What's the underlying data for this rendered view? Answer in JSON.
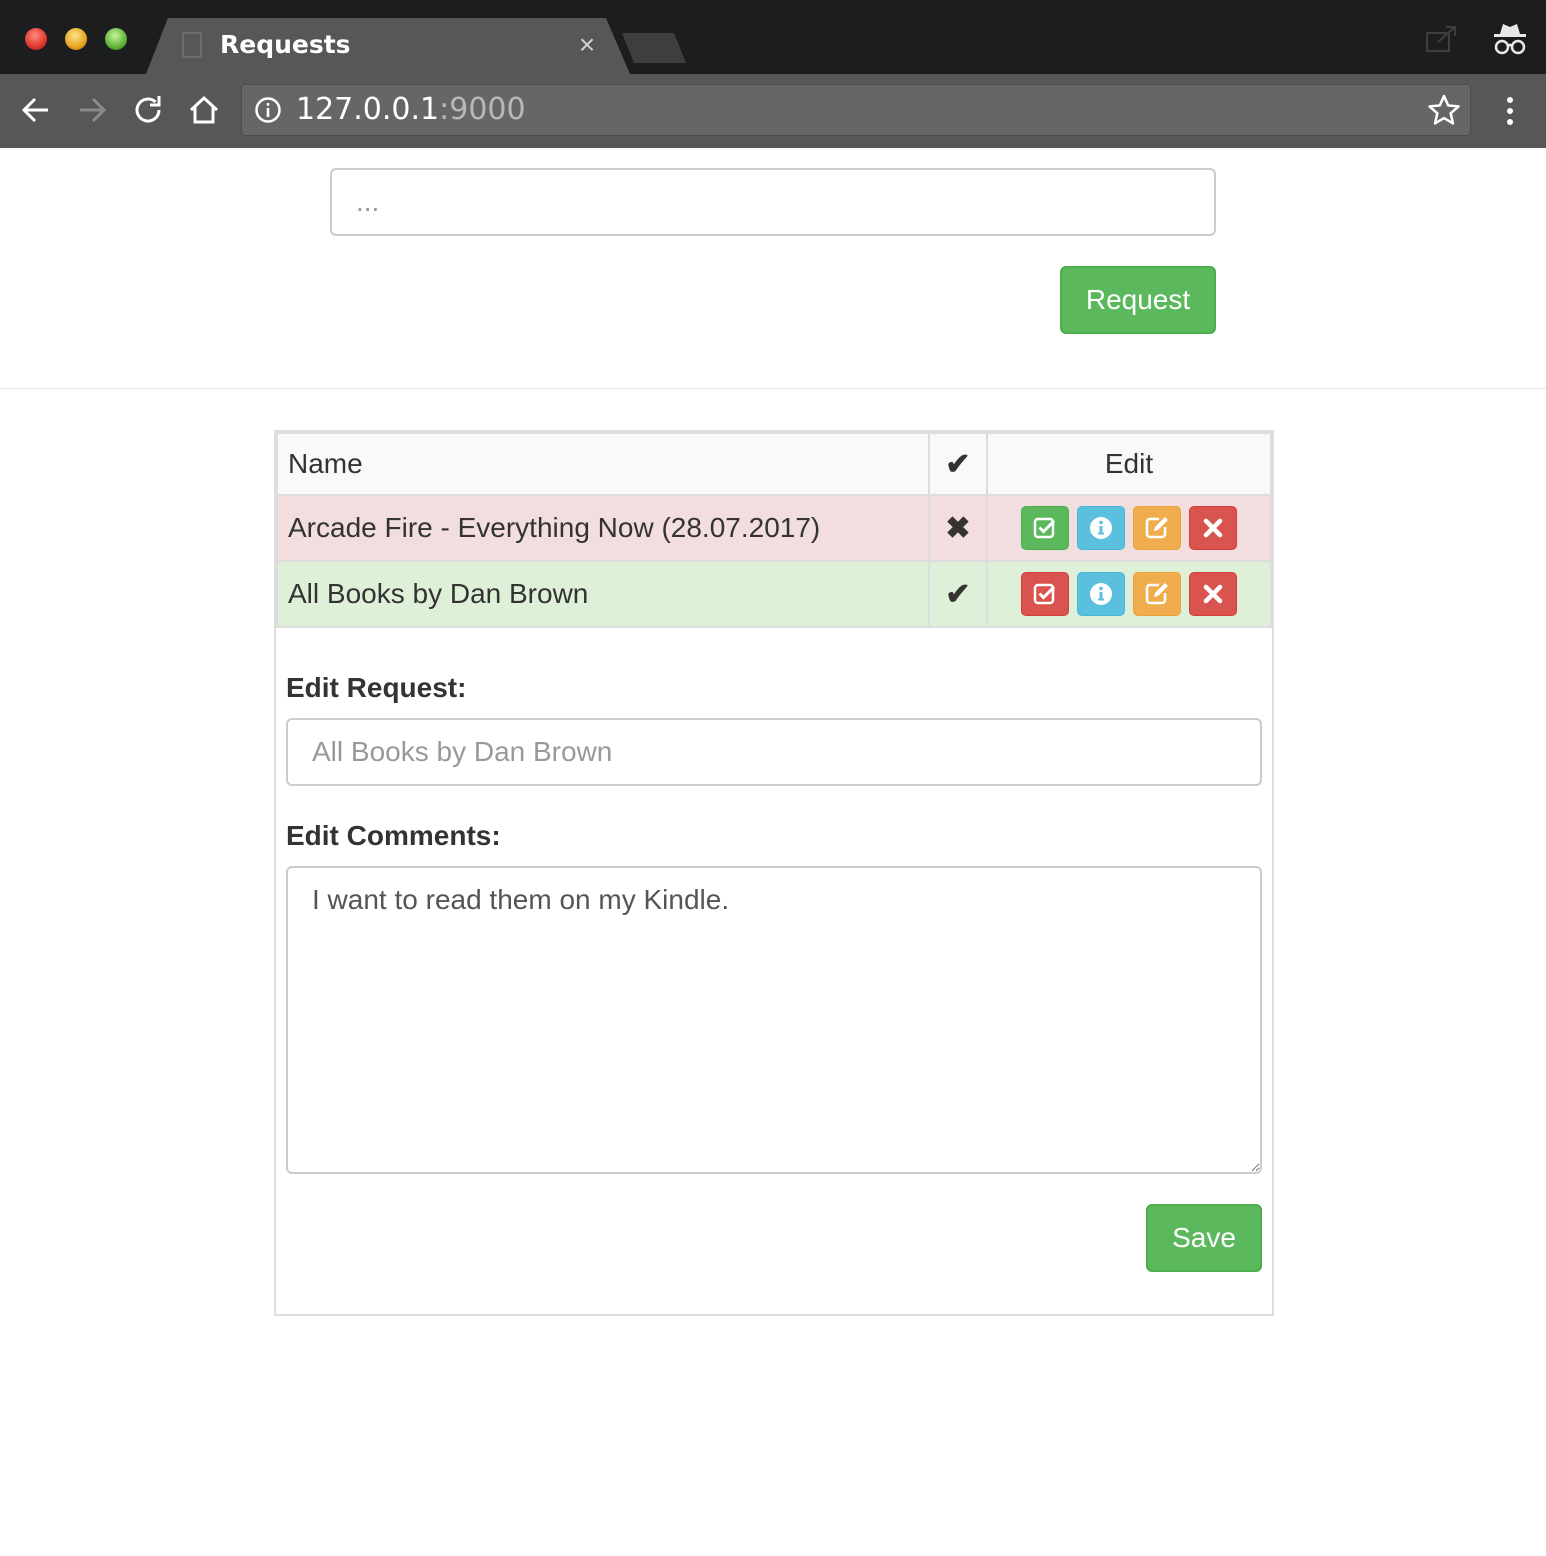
{
  "browser": {
    "tab_title": "Requests",
    "tab_close": "×",
    "url_host": "127.0.0.1",
    "url_port": ":9000"
  },
  "form": {
    "request_placeholder": "...",
    "request_button": "Request"
  },
  "table": {
    "headers": {
      "name": "Name",
      "check": "✔",
      "edit": "Edit"
    },
    "rows": [
      {
        "name": "Arcade Fire - Everything Now (28.07.2017)",
        "status_mark": "✖",
        "status": "danger",
        "toggle_color": "green"
      },
      {
        "name": "All Books by Dan Brown",
        "status_mark": "✔",
        "status": "success",
        "toggle_color": "red"
      }
    ],
    "action_icons": [
      "check-square-icon",
      "info-icon",
      "edit-icon",
      "remove-icon"
    ]
  },
  "edit": {
    "request_label": "Edit Request:",
    "request_placeholder": "All Books by Dan Brown",
    "comments_label": "Edit Comments:",
    "comments_value": "I want to read them on my Kindle.",
    "save_button": "Save"
  },
  "colors": {
    "success": "#5cb85c",
    "danger": "#d9534f",
    "info": "#5bc0de",
    "warning": "#f0ad4e",
    "row_danger_bg": "#f2dede",
    "row_success_bg": "#dff0d8"
  }
}
